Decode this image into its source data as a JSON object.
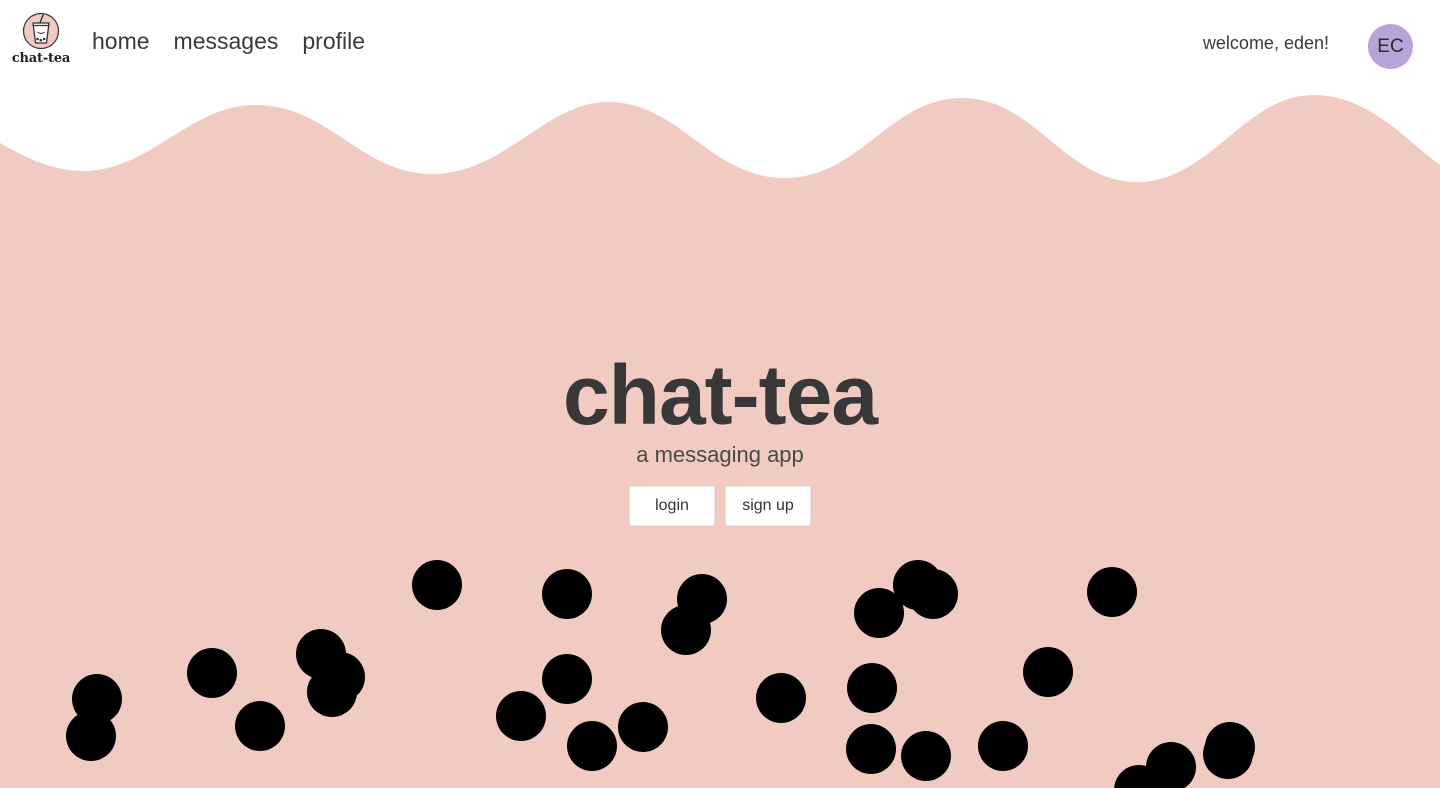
{
  "app": {
    "logo_text": "chat-tea",
    "logo_icon": "bubble-tea-cup-icon"
  },
  "nav": {
    "links": [
      {
        "label": "home"
      },
      {
        "label": "messages"
      },
      {
        "label": "profile"
      }
    ]
  },
  "user": {
    "welcome": "welcome, eden!",
    "initials": "EC",
    "avatar_color": "#b8a2d6"
  },
  "hero": {
    "title": "chat-tea",
    "subtitle": "a messaging app",
    "login_label": "login",
    "signup_label": "sign up"
  },
  "colors": {
    "background": "#f1cbc2",
    "bubble": "#000000",
    "text": "#383838"
  }
}
